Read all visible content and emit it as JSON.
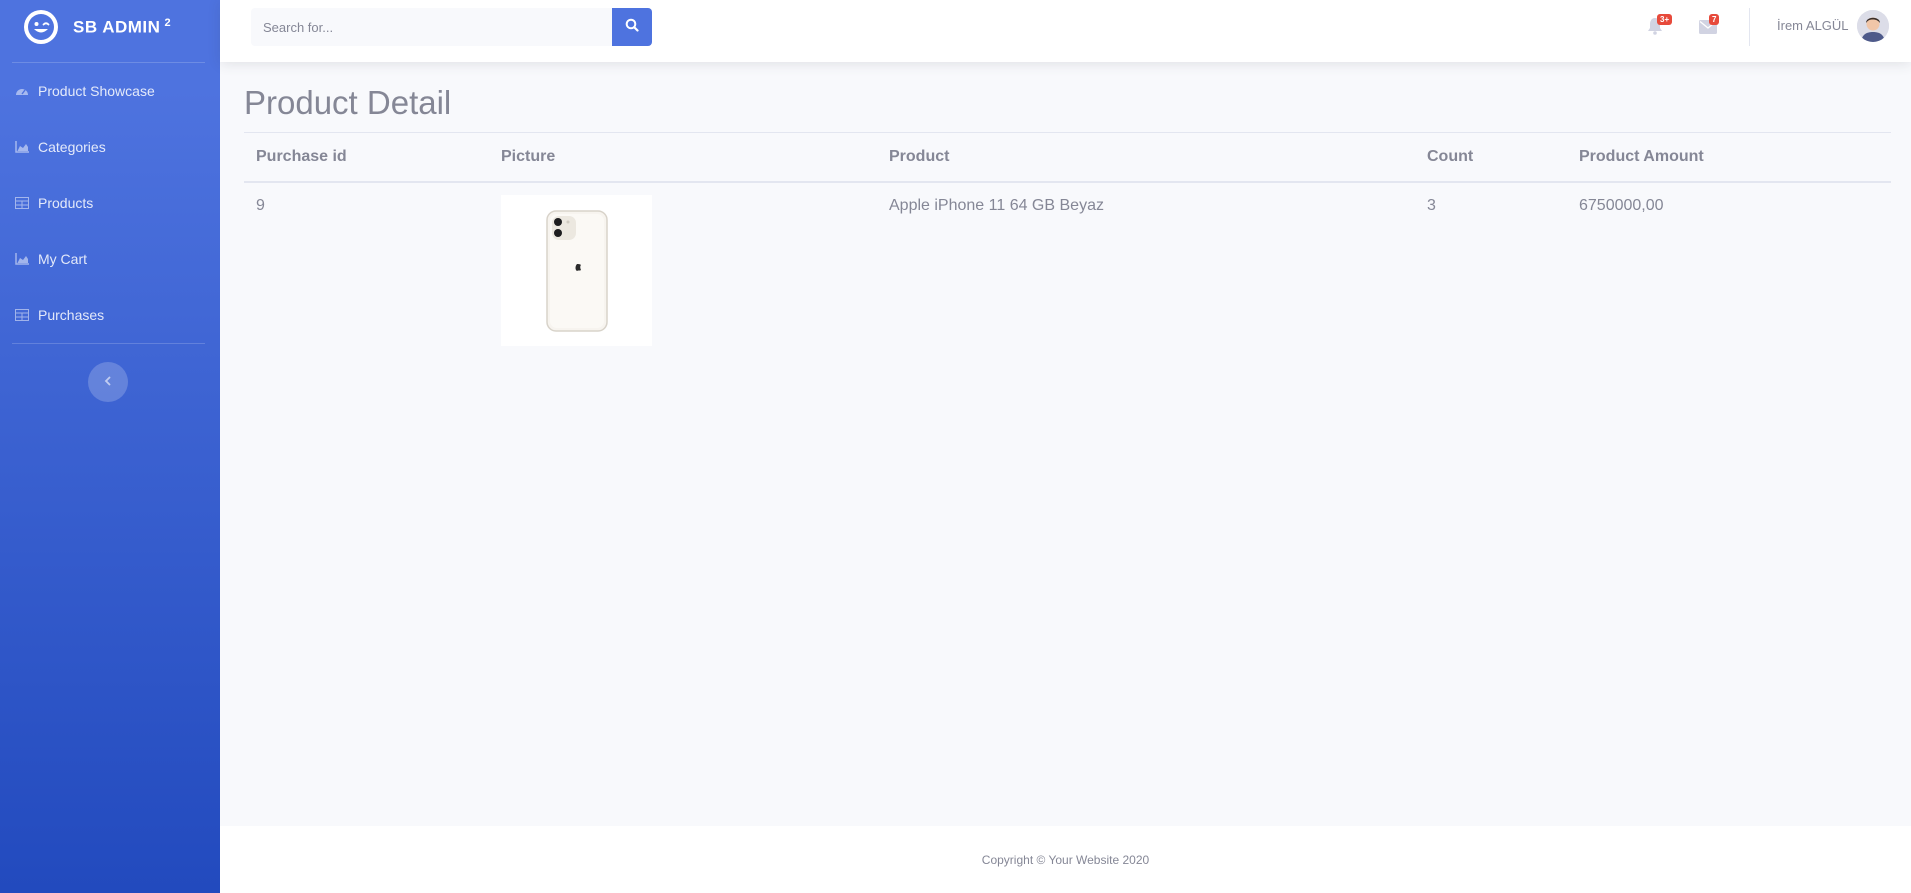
{
  "brand": {
    "name": "SB ADMIN",
    "sup": "2"
  },
  "sidebar": {
    "items": [
      {
        "label": "Product Showcase",
        "icon": "dashboard-icon"
      },
      {
        "label": "Categories",
        "icon": "chart-area-icon"
      },
      {
        "label": "Products",
        "icon": "table-icon"
      },
      {
        "label": "My Cart",
        "icon": "chart-area-icon"
      },
      {
        "label": "Purchases",
        "icon": "table-icon"
      }
    ]
  },
  "topbar": {
    "search_placeholder": "Search for...",
    "alerts_badge": "3+",
    "messages_badge": "7",
    "username": "İrem ALGÜL"
  },
  "page": {
    "title": "Product Detail"
  },
  "table": {
    "headers": [
      "Purchase id",
      "Picture",
      "Product",
      "Count",
      "Product Amount"
    ],
    "rows": [
      {
        "purchase_id": "9",
        "picture": "iphone-image",
        "product": "Apple iPhone 11 64 GB Beyaz",
        "count": "3",
        "amount": "6750000,00"
      }
    ]
  },
  "footer": {
    "copyright": "Copyright © Your Website 2020"
  },
  "colors": {
    "primary": "#4e73df",
    "danger": "#e74a3b",
    "text": "#858796"
  }
}
